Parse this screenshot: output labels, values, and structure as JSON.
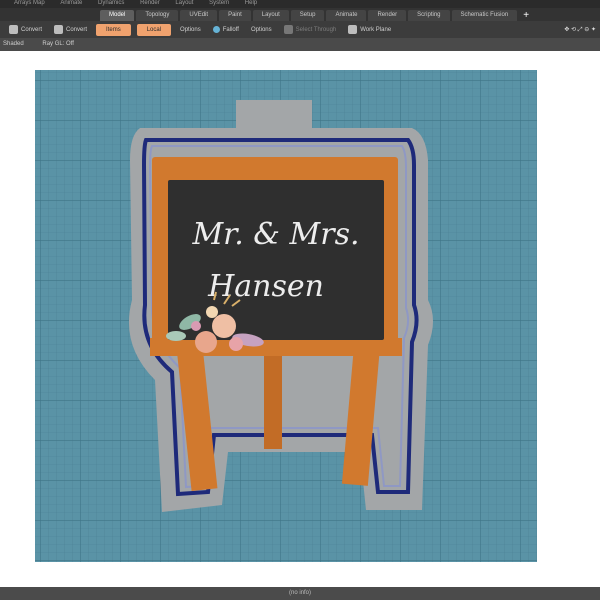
{
  "menu": [
    "Arrays Map",
    "Animate",
    "Dynamics",
    "Render",
    "Layout",
    "System",
    "Help"
  ],
  "tabs": [
    {
      "label": "Model",
      "active": true
    },
    {
      "label": "Topology",
      "active": false
    },
    {
      "label": "UVEdit",
      "active": false
    },
    {
      "label": "Paint",
      "active": false
    },
    {
      "label": "Layout",
      "active": false
    },
    {
      "label": "Setup",
      "active": false
    },
    {
      "label": "Animate",
      "active": false
    },
    {
      "label": "Render",
      "active": false
    },
    {
      "label": "Scripting",
      "active": false
    },
    {
      "label": "Schematic Fusion",
      "active": false
    }
  ],
  "tab_add": "+",
  "toolbar": {
    "convert_1": "Convert",
    "convert_2": "Convert",
    "items": "Items",
    "local": "Local",
    "options_1": "Options",
    "falloff": "Falloff",
    "options_2": "Options",
    "select_through": "Select Through",
    "work_plane": "Work Plane",
    "viewport_icons": "✥ ⟲ ⤢ ⊖ ✦"
  },
  "status": {
    "shading": "Shaded",
    "ray_gl": "Ray GL: Off"
  },
  "artwork": {
    "line_1": "Mr. & Mrs.",
    "line_2": "Hansen"
  },
  "footer": "(no info)",
  "colors": {
    "grid_bg": "#5a93a6",
    "grid_line": "#4a7f94",
    "cutter_gray": "#a3a6a8",
    "cutter_outline": "#1e2a7a",
    "easel_wood": "#d1792e",
    "chalkboard": "#2f2f2f",
    "chalk_text": "#ededed",
    "orange_button": "#f0a26e"
  }
}
